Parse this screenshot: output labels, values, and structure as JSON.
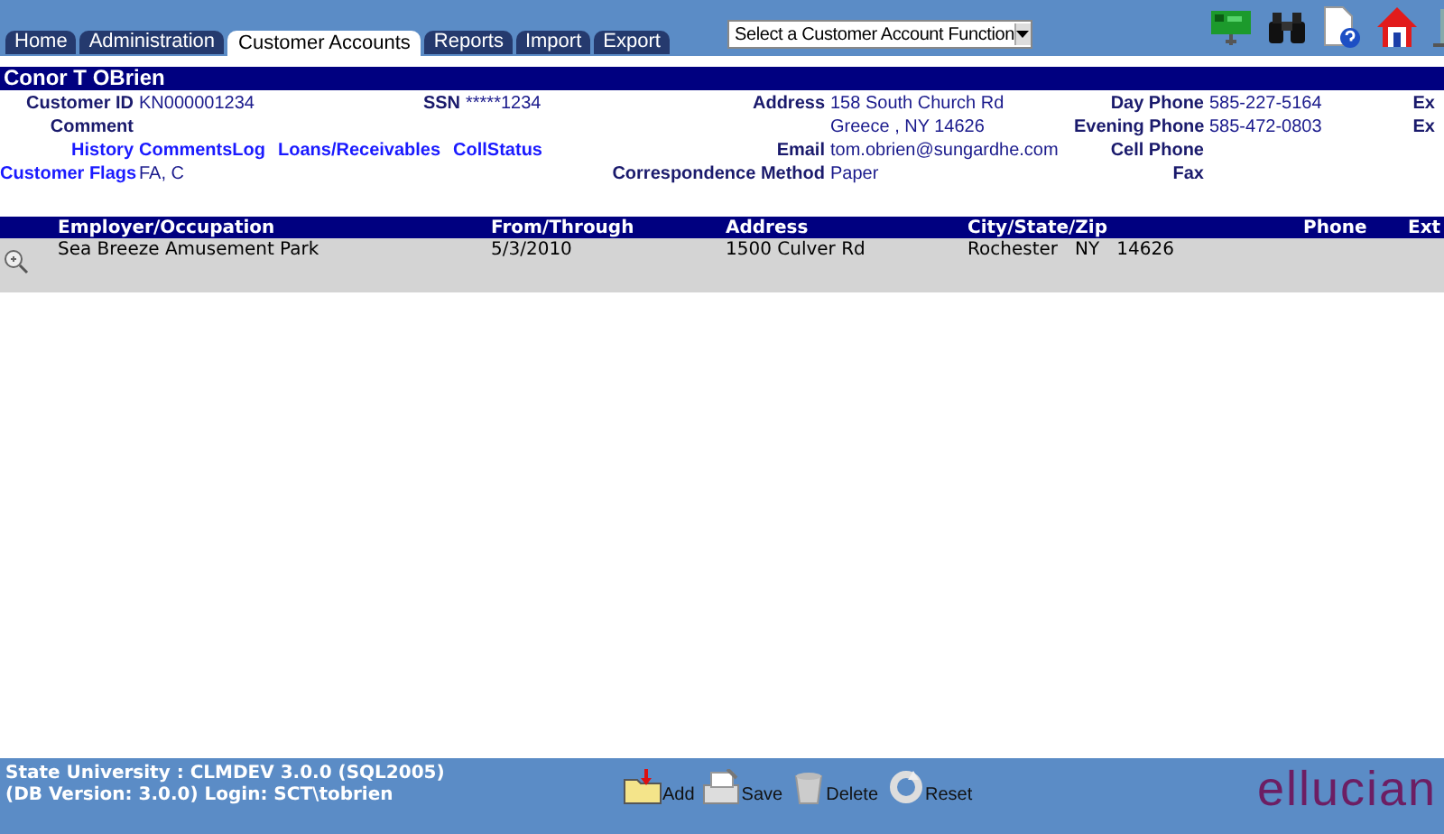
{
  "tabs": [
    {
      "label": "Home",
      "selected": false
    },
    {
      "label": "Administration",
      "selected": false
    },
    {
      "label": "Customer Accounts",
      "selected": true
    },
    {
      "label": "Reports",
      "selected": false
    },
    {
      "label": "Import",
      "selected": false
    },
    {
      "label": "Export",
      "selected": false
    }
  ],
  "function_select": {
    "value": "Select a Customer Account Function"
  },
  "customer": {
    "name": "Conor T OBrien",
    "rows": [
      [
        {
          "label": "Customer ID",
          "kind": "text",
          "value": "KN000001234"
        },
        {
          "label": "SSN",
          "kind": "text",
          "value": "*****1234"
        },
        {
          "label": "Address",
          "kind": "text",
          "value": "158 South Church Rd"
        },
        {
          "label": "Day Phone",
          "kind": "text",
          "value": "585-227-5164"
        },
        {
          "label": "Ex",
          "kind": "text"
        }
      ],
      [
        {
          "label": "Comment",
          "kind": "text"
        },
        {
          "kind": "empty"
        },
        {
          "kind": "text",
          "value": "Greece , NY 14626"
        },
        {
          "label": "Evening Phone",
          "kind": "text",
          "value": "585-472-0803"
        },
        {
          "label": "Ex",
          "kind": "text"
        }
      ],
      [
        {
          "label": "History",
          "kind": "link",
          "links": [
            "CommentsLog",
            "Loans/Receivables",
            "CollStatus"
          ]
        },
        {
          "kind": "empty"
        },
        {
          "label": "Email",
          "kind": "text",
          "value": "tom.obrien@sungardhe.com"
        },
        {
          "label": "Cell Phone",
          "kind": "text"
        }
      ],
      [
        {
          "label": "Customer Flags",
          "kind": "link",
          "value": "FA, C"
        },
        {
          "kind": "empty"
        },
        {
          "label": "Correspondence Method",
          "kind": "text",
          "value": "Paper"
        },
        {
          "label": "Fax",
          "kind": "text"
        }
      ]
    ]
  },
  "table": {
    "columns": [
      "Employer/Occupation",
      "From/Through",
      "Address",
      "City/State/Zip",
      "Phone",
      "Ext"
    ],
    "rows": [
      {
        "cells": [
          "Sea Breeze Amusement Park",
          "5/3/2010",
          "1500 Culver Rd",
          "Rochester   NY   14626",
          "",
          ""
        ]
      }
    ]
  },
  "footer": {
    "lines": [
      "State University : CLMDEV 3.0.0 (SQL2005)",
      "(DB Version: 3.0.0) Login: SCT\\tobrien"
    ],
    "buttons": [
      {
        "kind": "add",
        "label": "Add"
      },
      {
        "kind": "save",
        "label": "Save"
      },
      {
        "kind": "delete",
        "label": "Delete"
      },
      {
        "kind": "reset",
        "label": "Reset"
      }
    ],
    "logo": "ellucian"
  }
}
